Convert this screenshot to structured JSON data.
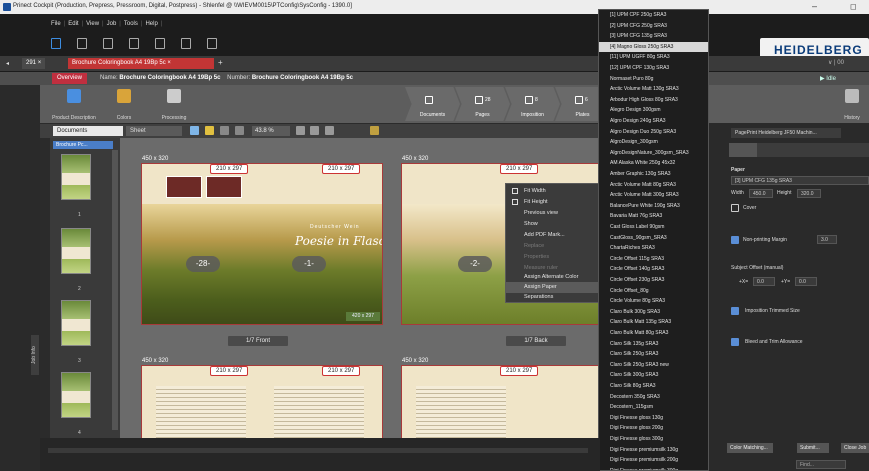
{
  "window": {
    "title": "Prinect Cockpit (Production, Prepress, Pressroom, Digital, Postpress) - Shlenfel @ \\\\WIEVM0015\\PTConfig\\SysConfig - 1390.0]",
    "minimize": "–",
    "maximize": "◻"
  },
  "menu": {
    "items": [
      "File",
      "Edit",
      "View",
      "Job",
      "Tools",
      "Help"
    ],
    "separator": "|"
  },
  "brand": {
    "logo_text": "HEIDELBERG"
  },
  "tabs": {
    "pin": "◂",
    "job_number": "291",
    "job_tab_close": "×",
    "active_tab": "Brochure Coloringbook A4 19Bp 5c",
    "active_tab_close": "×",
    "add": "+",
    "right_controls": "∨  |  00"
  },
  "subbar": {
    "overview": "Overview",
    "name_label": "Name:",
    "name_value": "Brochure Coloringbook A4 19Bp 5c",
    "number_label": "Number:",
    "number_value": "Brochure Coloringbook A4 19Bp 5c",
    "right_status": "▶ Idle"
  },
  "workflow": {
    "left_steps": [
      {
        "label": "Product Description",
        "color": "#4a8fe0"
      },
      {
        "label": "Colors",
        "color": "#d9a43a"
      },
      {
        "label": "Processing",
        "color": "#ccc"
      }
    ],
    "pipeline": [
      {
        "label": "Documents",
        "count": ""
      },
      {
        "label": "Pages",
        "count": "28"
      },
      {
        "label": "Imposition",
        "count": "8"
      },
      {
        "label": "Plates",
        "count": "6"
      }
    ],
    "right_label": "History"
  },
  "sidebar": {
    "job_info_label": "Job Info"
  },
  "toolbar": {
    "documents_select": "Documents",
    "sheet_select": "Sheet",
    "zoom": "43.8 %"
  },
  "thumbnails": {
    "header": "Brochure Pc...",
    "pages": [
      "1",
      "2",
      "3",
      "4"
    ]
  },
  "canvas": {
    "spreads": [
      {
        "size": "450 x 320",
        "tag_left": "210 x 297",
        "tag_right": "210 x 297",
        "page_left": "-28-",
        "page_right": "-1-",
        "title": "Poesie in Flaschen",
        "subtitle": "Deutscher Wein",
        "corner": "420 x 297",
        "footer": "1/7 Front"
      },
      {
        "size": "450 x 320",
        "tag_left": "210 x 297",
        "page_left": "-2-",
        "footer": "1/7 Back"
      },
      {
        "size": "450 x 320",
        "tag_left": "210 x 297",
        "tag_right": "210 x 297"
      },
      {
        "size": "450 x 320",
        "tag_left": "210 x 297"
      }
    ]
  },
  "context_menu": {
    "items": [
      {
        "label": "Fit Width",
        "check": true,
        "submenu": false,
        "dim": false
      },
      {
        "label": "Fit Height",
        "check": true,
        "submenu": false,
        "dim": false
      },
      {
        "label": "Previous view",
        "check": false,
        "submenu": false,
        "dim": false
      },
      {
        "label": "Show",
        "check": false,
        "submenu": true,
        "dim": false
      },
      {
        "label": "Add PDF Mark...",
        "check": false,
        "submenu": false,
        "dim": false
      },
      {
        "label": "Replace",
        "check": false,
        "submenu": false,
        "dim": true
      },
      {
        "label": "Properties",
        "check": false,
        "submenu": false,
        "dim": true
      },
      {
        "label": "Measure ruler",
        "check": false,
        "submenu": false,
        "dim": true
      },
      {
        "label": "Assign Alternate Color",
        "check": false,
        "submenu": true,
        "dim": false
      },
      {
        "label": "Assign Paper",
        "check": false,
        "submenu": true,
        "dim": false,
        "highlight": true
      },
      {
        "label": "Separations",
        "check": false,
        "submenu": true,
        "dim": false
      }
    ]
  },
  "paper_list": {
    "selected_index": 3,
    "items": [
      "[1] UPM CPF 250g SRA3",
      "[2] UPM CFG 250g SRA3",
      "[3] UPM CFG 135g SRA3",
      "[4] Magno Gloss 250g SRA3",
      "[11] UPM UGFF 80g SRA3",
      "[12] UPM CPF 130g SRA3",
      "Normaset Puro 80g",
      "Arctic Volume Matt 130g SRA3",
      "Arbodur High Gloss 80g SRA3",
      "Alegro Design 300gsm",
      "Algro Design 240g SRA3",
      "Algro Design Duo 250g SRA3",
      "AlgroDesign_300gsm",
      "AlgroDesignNature_300gsm_SRA3",
      "AM Alaska White 250g 45x32",
      "Amber Graphic 130g SRA3",
      "Arctic Volume Matt 80g SRA3",
      "Arctic Volume Matt 300g SRA3",
      "BalancePure White 190g SRA3",
      "Bavaria Matt 76g SRA3",
      "Cast Gloss Label 90gsm",
      "CastGloss_90gsm_SRA3",
      "ChartaRiches SRA3",
      "Circle Offset 115g SRA3",
      "Circle Offset 140g SRA3",
      "Circle Offset 230g SRA3",
      "Circle Offset_80g",
      "Circle Volume 80g SRA3",
      "Claro Bulk 300g SRA3",
      "Claro Bulk Matt 135g SRA3",
      "Claro Bulk Matt 80g SRA3",
      "Claro Silk 135g SRA3",
      "Claro Silk 250g SRA3",
      "Claro Silk 250g SRA3 new",
      "Claro Silk 300g SRA3",
      "Claro Silk 80g SRA3",
      "Decostern 350g SRA3",
      "Decostern_115gsm",
      "Digi Finesse gloss 130g",
      "Digi Finesse gloss 200g",
      "Digi Finesse gloss 300g",
      "Digi Finesse premiumsilk 130g",
      "Digi Finesse premiumsilk 200g",
      "Digi Finesse premiumsilk 300g",
      "Digiline Jet 80g"
    ]
  },
  "right_panel": {
    "device": "PagePrint Heidelberg JF50 Machin...",
    "paper_label": "Paper",
    "paper_value": "[3] UPM CFG 135g SRA3",
    "width_label": "Width",
    "width_value": "450.0",
    "height_label": "Height",
    "height_value": "320.0",
    "cover_label": "Cover",
    "non_printing_label": "Non-printing Margin",
    "non_printing_value": "3.0",
    "subject_offset_label": "Subject Offset (manual)",
    "offset_x_label": "+X=",
    "offset_x_value": "0.0",
    "offset_y_label": "+Y=",
    "offset_y_value": "0.0",
    "imposition_label": "Imposition Trimmed Size",
    "bleed_label": "Bleed and Trim Allowance",
    "btn_color_matching": "Color Matching...",
    "btn_submit": "Submit...",
    "btn_close_job": "Close Job",
    "find_placeholder": "Find..."
  }
}
